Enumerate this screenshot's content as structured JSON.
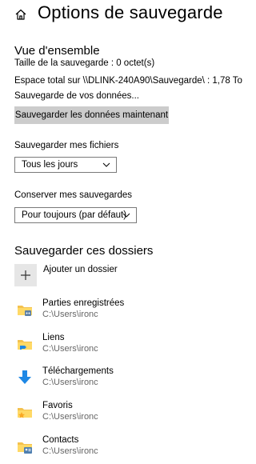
{
  "header": {
    "title": "Options de sauvegarde"
  },
  "overview": {
    "title": "Vue d'ensemble",
    "backup_size": "Taille de la sauvegarde : 0 octet(s)",
    "total_space": "Espace total sur \\\\DLINK-240A90\\Sauvegarde\\ : 1,78 To",
    "status": "Sauvegarde de vos données...",
    "backup_now_label": "Sauvegarder les données maintenant"
  },
  "frequency": {
    "label": "Sauvegarder mes fichiers",
    "selected": "Tous les jours"
  },
  "retention": {
    "label": "Conserver mes sauvegardes",
    "selected": "Pour toujours (par défaut)"
  },
  "folders": {
    "title": "Sauvegarder ces dossiers",
    "add_label": "Ajouter un dossier",
    "items": [
      {
        "name": "Parties enregistrées",
        "path": "C:\\Users\\ironc",
        "icon": "saved-games-folder-icon"
      },
      {
        "name": "Liens",
        "path": "C:\\Users\\ironc",
        "icon": "links-folder-icon"
      },
      {
        "name": "Téléchargements",
        "path": "C:\\Users\\ironc",
        "icon": "downloads-icon"
      },
      {
        "name": "Favoris",
        "path": "C:\\Users\\ironc",
        "icon": "favorites-folder-icon"
      },
      {
        "name": "Contacts",
        "path": "C:\\Users\\ironc",
        "icon": "contacts-folder-icon"
      }
    ]
  },
  "colors": {
    "button_bg": "#cccccc",
    "secondary_text": "#666666",
    "folder_yellow": "#f4c24f",
    "download_blue": "#1e88e5"
  }
}
